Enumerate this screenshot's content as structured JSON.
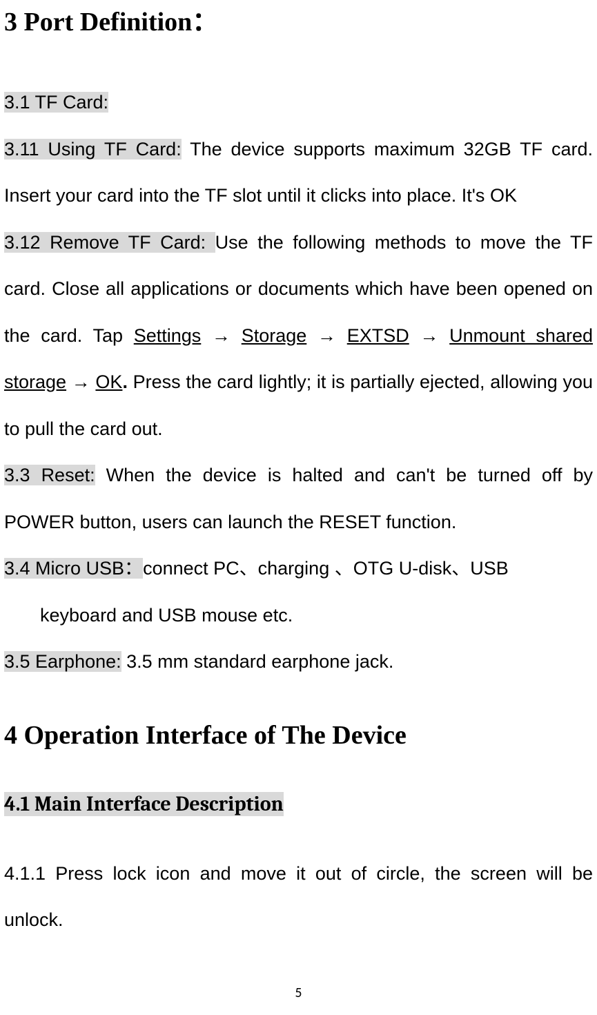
{
  "section3": {
    "title": "3 Port Definition：",
    "s31_label": "3.1 TF Card:",
    "s311_label": "3.11 Using TF Card:",
    "s311_text": " The device supports maximum 32GB TF card. Insert your card into the TF slot until it clicks into place. It's OK",
    "s312_label": "3.12 Remove TF Card: ",
    "s312_pre": "Use the following methods to move the TF card. Close all applications or documents which have been opened on the card. Tap ",
    "nav_settings": "Settings",
    "arrow": " → ",
    "nav_storage": "Storage",
    "nav_extsd": "EXTSD",
    "nav_unmount": "Unmount shared storage",
    "nav_ok": " OK",
    "period": ".",
    "s312_post": " Press the card lightly; it is partially ejected, allowing you to pull the card out.",
    "s33_label": "3.3 Reset:",
    "s33_text": " When the device is halted and can't be turned off by POWER button, users can launch the RESET function.",
    "s34_label": "3.4  Micro USB：",
    "s34_text_a": "connect PC、charging 、OTG U-disk、USB",
    "s34_text_b": "keyboard and USB mouse etc.",
    "s35_label": "3.5 Earphone:",
    "s35_text": " 3.5 mm standard earphone jack."
  },
  "section4": {
    "title": "4 Operation Interface of The Device",
    "s41_label": "4.1 Main Interface Description",
    "s411_text": "4.1.1 Press lock icon and move it out of circle, the screen will be unlock."
  },
  "page_number": "5"
}
